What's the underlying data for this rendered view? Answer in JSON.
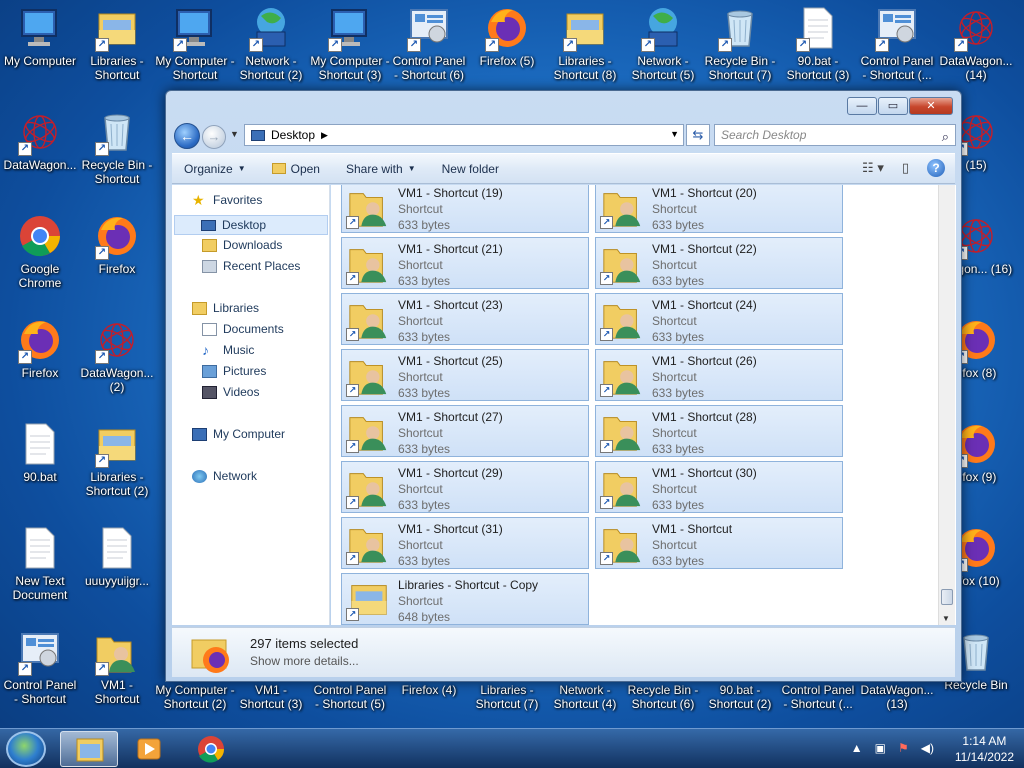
{
  "desktop": {
    "icons": [
      {
        "label": "My Computer",
        "kind": "computer",
        "shortcut": false
      },
      {
        "label": "Libraries - Shortcut",
        "kind": "libraries",
        "shortcut": true
      },
      {
        "label": "My Computer - Shortcut",
        "kind": "computer",
        "shortcut": true
      },
      {
        "label": "Network - Shortcut (2)",
        "kind": "network",
        "shortcut": true
      },
      {
        "label": "My Computer - Shortcut (3)",
        "kind": "computer",
        "shortcut": true
      },
      {
        "label": "Control Panel - Shortcut (6)",
        "kind": "control",
        "shortcut": true
      },
      {
        "label": "Firefox (5)",
        "kind": "firefox",
        "shortcut": true
      },
      {
        "label": "Libraries - Shortcut (8)",
        "kind": "libraries",
        "shortcut": true
      },
      {
        "label": "Network - Shortcut (5)",
        "kind": "network",
        "shortcut": true
      },
      {
        "label": "Recycle Bin - Shortcut (7)",
        "kind": "recycle",
        "shortcut": true
      },
      {
        "label": "90.bat - Shortcut (3)",
        "kind": "file",
        "shortcut": true
      },
      {
        "label": "Control Panel - Shortcut (...",
        "kind": "control",
        "shortcut": true
      },
      {
        "label": "DataWagon... (14)",
        "kind": "datawagon",
        "shortcut": true
      },
      {
        "label": "DataWagon...",
        "kind": "datawagon",
        "shortcut": true
      },
      {
        "label": "Recycle Bin - Shortcut",
        "kind": "recycle",
        "shortcut": true
      },
      {
        "label": "Google Chrome",
        "kind": "chrome",
        "shortcut": false
      },
      {
        "label": "Firefox",
        "kind": "firefox",
        "shortcut": true
      },
      {
        "label": "Firefox",
        "kind": "firefox",
        "shortcut": true
      },
      {
        "label": "DataWagon... (2)",
        "kind": "datawagon",
        "shortcut": true
      },
      {
        "label": "90.bat",
        "kind": "file",
        "shortcut": false
      },
      {
        "label": "Libraries - Shortcut (2)",
        "kind": "libraries",
        "shortcut": true
      },
      {
        "label": "New Text Document",
        "kind": "file",
        "shortcut": false
      },
      {
        "label": "uuuyyuijgr...",
        "kind": "file",
        "shortcut": false
      },
      {
        "label": "Control Panel - Shortcut",
        "kind": "control",
        "shortcut": true
      },
      {
        "label": "VM1 - Shortcut",
        "kind": "user",
        "shortcut": true
      },
      {
        "label": "(15)",
        "kind": "datawagon",
        "shortcut": true
      },
      {
        "label": "Wagon... (16)",
        "kind": "datawagon",
        "shortcut": true
      },
      {
        "label": "efox (8)",
        "kind": "firefox",
        "shortcut": true
      },
      {
        "label": "efox (9)",
        "kind": "firefox",
        "shortcut": true
      },
      {
        "label": "efox (10)",
        "kind": "firefox",
        "shortcut": true
      },
      {
        "label": "Recycle Bin",
        "kind": "recycle",
        "shortcut": false
      }
    ],
    "bottom_row": [
      "My Computer - Shortcut (2)",
      "VM1 - Shortcut (3)",
      "Control Panel - Shortcut (5)",
      "Firefox (4)",
      "Libraries - Shortcut (7)",
      "Network - Shortcut (4)",
      "Recycle Bin - Shortcut (6)",
      "90.bat - Shortcut (2)",
      "Control Panel - Shortcut (...",
      "DataWagon... (13)"
    ]
  },
  "window": {
    "minimize": "—",
    "maximize": "▭",
    "close": "✕",
    "address_crumb": "Desktop",
    "search_placeholder": "Search Desktop",
    "toolbar": {
      "organize": "Organize",
      "open": "Open",
      "share_with": "Share with",
      "new_folder": "New folder"
    },
    "nav": {
      "favorites": "Favorites",
      "desktop": "Desktop",
      "downloads": "Downloads",
      "recent_places": "Recent Places",
      "libraries": "Libraries",
      "documents": "Documents",
      "music": "Music",
      "pictures": "Pictures",
      "videos": "Videos",
      "my_computer": "My Computer",
      "network": "Network"
    },
    "files": [
      {
        "name": "VM1 - Shortcut (19)",
        "type": "Shortcut",
        "size": "633 bytes",
        "kind": "user"
      },
      {
        "name": "VM1 - Shortcut (20)",
        "type": "Shortcut",
        "size": "633 bytes",
        "kind": "user"
      },
      {
        "name": "VM1 - Shortcut (21)",
        "type": "Shortcut",
        "size": "633 bytes",
        "kind": "user"
      },
      {
        "name": "VM1 - Shortcut (22)",
        "type": "Shortcut",
        "size": "633 bytes",
        "kind": "user"
      },
      {
        "name": "VM1 - Shortcut (23)",
        "type": "Shortcut",
        "size": "633 bytes",
        "kind": "user"
      },
      {
        "name": "VM1 - Shortcut (24)",
        "type": "Shortcut",
        "size": "633 bytes",
        "kind": "user"
      },
      {
        "name": "VM1 - Shortcut (25)",
        "type": "Shortcut",
        "size": "633 bytes",
        "kind": "user"
      },
      {
        "name": "VM1 - Shortcut (26)",
        "type": "Shortcut",
        "size": "633 bytes",
        "kind": "user"
      },
      {
        "name": "VM1 - Shortcut (27)",
        "type": "Shortcut",
        "size": "633 bytes",
        "kind": "user"
      },
      {
        "name": "VM1 - Shortcut (28)",
        "type": "Shortcut",
        "size": "633 bytes",
        "kind": "user"
      },
      {
        "name": "VM1 - Shortcut (29)",
        "type": "Shortcut",
        "size": "633 bytes",
        "kind": "user"
      },
      {
        "name": "VM1 - Shortcut (30)",
        "type": "Shortcut",
        "size": "633 bytes",
        "kind": "user"
      },
      {
        "name": "VM1 - Shortcut (31)",
        "type": "Shortcut",
        "size": "633 bytes",
        "kind": "user"
      },
      {
        "name": "VM1 - Shortcut",
        "type": "Shortcut",
        "size": "633 bytes",
        "kind": "user"
      },
      {
        "name": "Libraries - Shortcut - Copy",
        "type": "Shortcut",
        "size": "648 bytes",
        "kind": "libraries"
      }
    ],
    "details": {
      "count": "297 items selected",
      "more": "Show more details..."
    }
  },
  "taskbar": {
    "time": "1:14 AM",
    "date": "11/14/2022"
  },
  "colors": {
    "selection_fill": "#cfe1f7",
    "selection_border": "#8fb3dc",
    "desktop_blue": "#1f73c9"
  }
}
